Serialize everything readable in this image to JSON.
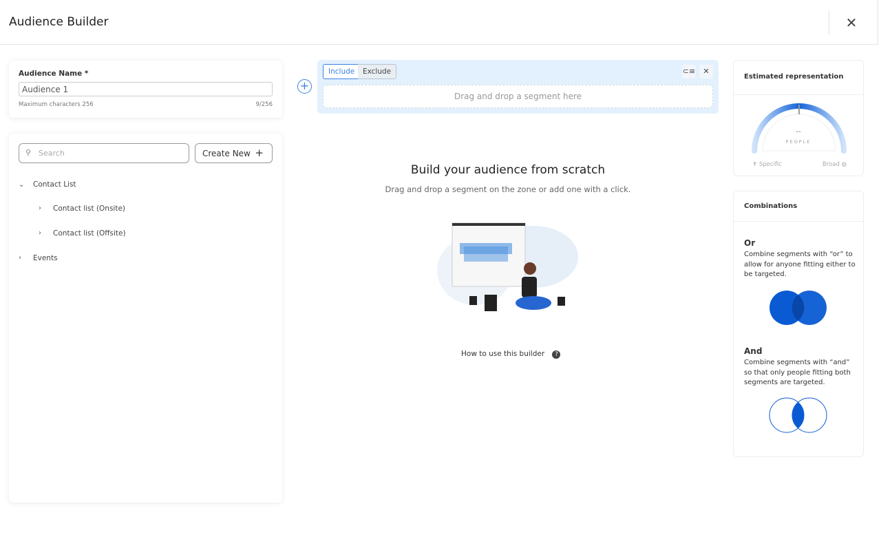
{
  "header": {
    "title": "Audience Builder",
    "close_icon": "close-icon"
  },
  "audience": {
    "label": "Audience Name *",
    "value": "Audience 1",
    "hint": "Maximum characters 256",
    "count": "9/256"
  },
  "library": {
    "search_placeholder": "Search",
    "create_label": "Create New",
    "create_icon": "+",
    "tree": [
      {
        "label": "Contact List",
        "expanded": true,
        "children": [
          {
            "label": "Contact list (Onsite)"
          },
          {
            "label": "Contact list (Offsite)"
          }
        ]
      },
      {
        "label": "Events",
        "expanded": false
      }
    ]
  },
  "builder": {
    "include_label": "Include",
    "exclude_label": "Exclude",
    "drop_text": "Drag and drop a segment here",
    "empty_title": "Build your audience from scratch",
    "empty_sub": "Drag and drop a segment on the zone or add one with a click.",
    "help_link": "How to use this builder"
  },
  "estimate": {
    "title": "Estimated representation",
    "value": "--",
    "unit": "PEOPLE",
    "left": "Specific",
    "right": "Broad"
  },
  "combinations": {
    "title": "Combinations",
    "or_title": "Or",
    "or_text": "Combine segments with “or” to allow for anyone fitting either to be targeted.",
    "and_title": "And",
    "and_text": "Combine segments with “and” so that only people fitting both segments are targeted."
  },
  "colors": {
    "accent": "#3b82e0",
    "venn": "#0a5bd3",
    "zone": "#e3f0fd"
  }
}
